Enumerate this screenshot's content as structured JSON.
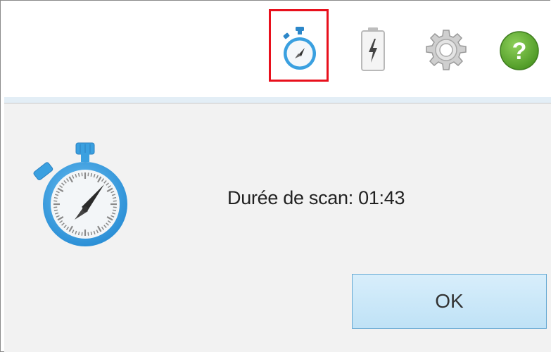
{
  "toolbar": {
    "icons": [
      "stopwatch-icon",
      "battery-icon",
      "gear-icon",
      "help-icon"
    ],
    "help_glyph": "?"
  },
  "dialog": {
    "message": "Durée de scan: 01:43",
    "ok_label": "OK"
  },
  "colors": {
    "timer_blue": "#3aa0e0",
    "highlight_red": "#e8101c",
    "help_green": "#6ab13b",
    "button_bg": "#c9e7f8"
  }
}
